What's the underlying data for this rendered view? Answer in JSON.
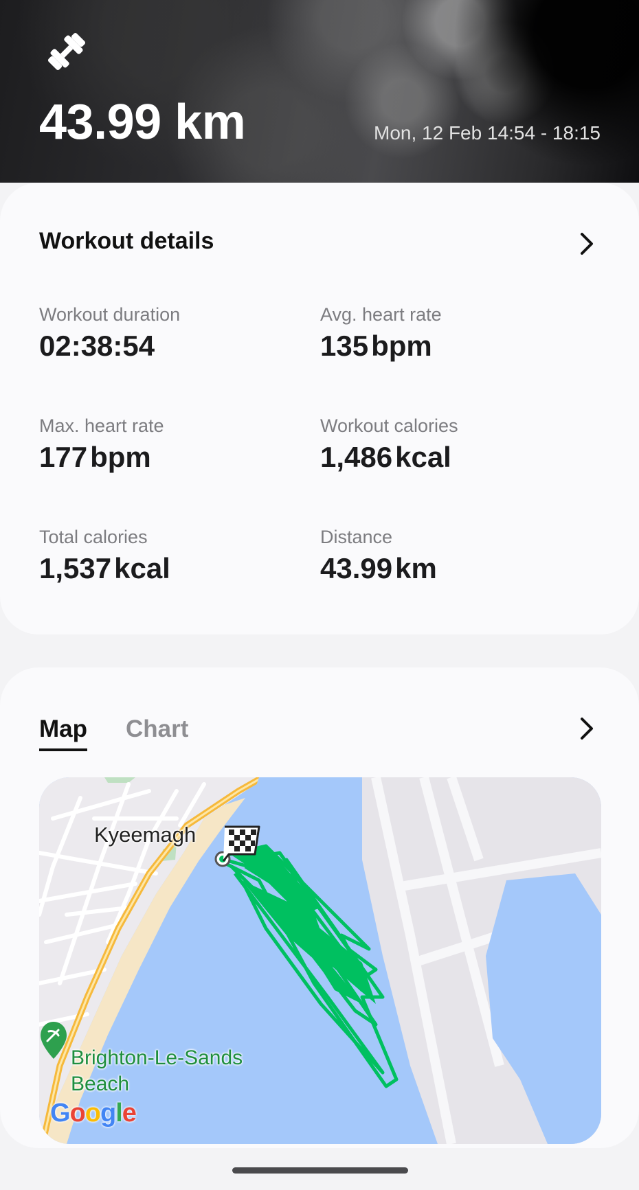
{
  "header": {
    "icon": "dumbbell-icon",
    "distance": "43.99 km",
    "date_range": "Mon, 12 Feb 14:54 - 18:15"
  },
  "details": {
    "title": "Workout details",
    "stats": {
      "workout_duration": {
        "label": "Workout duration",
        "value": "02:38:54"
      },
      "avg_heart_rate": {
        "label": "Avg. heart rate",
        "value": "135",
        "unit": "bpm"
      },
      "max_heart_rate": {
        "label": "Max. heart rate",
        "value": "177",
        "unit": "bpm"
      },
      "workout_calories": {
        "label": "Workout calories",
        "value": "1,486",
        "unit": "kcal"
      },
      "total_calories": {
        "label": "Total calories",
        "value": "1,537",
        "unit": "kcal"
      },
      "distance": {
        "label": "Distance",
        "value": "43.99",
        "unit": "km"
      }
    }
  },
  "map_section": {
    "tabs": [
      {
        "label": "Map",
        "selected": true
      },
      {
        "label": "Chart",
        "selected": false
      }
    ],
    "map": {
      "place_label": "Kyeemagh",
      "poi_line1": "Brighton-Le-Sands",
      "poi_line2": "Beach",
      "attribution": "Google",
      "route_color": "#00c060"
    }
  }
}
